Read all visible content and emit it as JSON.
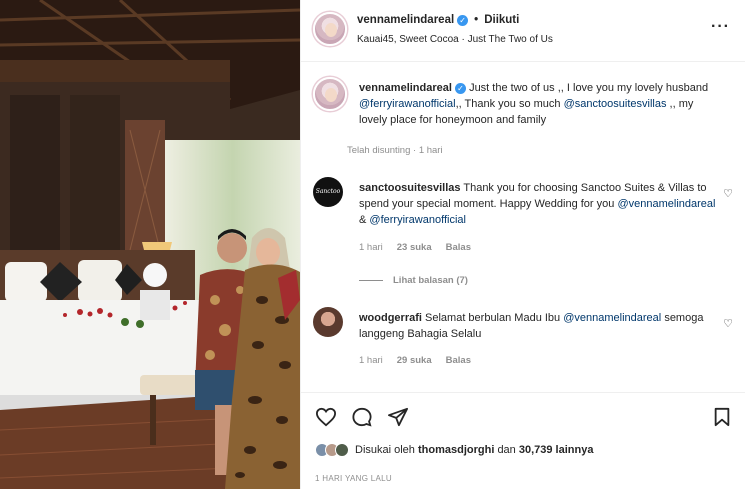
{
  "post": {
    "username": "vennamelindareal",
    "follow_status": "Diikuti",
    "location": "Kauai45, Sweet Cocoa · Just The Two of Us",
    "more_icon": "more-horizontal-icon"
  },
  "caption": {
    "username": "vennamelindareal",
    "text_1": "Just the two of us ,, I love you my lovely husband",
    "mention_1": "@ferryirawanofficial",
    "text_2": ",, Thank you so much",
    "mention_2": "@sanctoosuitesvillas",
    "text_3": ",, my lovely place for honeymoon and family",
    "edited": "Telah disunting · 1 hari"
  },
  "comments": [
    {
      "username": "sanctoosuitesvillas",
      "avatar_text": "Sanctoo Suites",
      "text_1": "Thank you for choosing Sanctoo Suites & Villas to spend your special moment. Happy Wedding for you",
      "mention_1": "@vennamelindareal",
      "text_2": "&",
      "mention_2": "@ferryirawanofficial",
      "time": "1 hari",
      "likes": "23 suka",
      "reply": "Balas",
      "view_replies": "Lihat balasan (7)"
    },
    {
      "username": "woodgerrafi",
      "text_1": "Selamat berbulan Madu Ibu",
      "mention_1": "@vennamelindareal",
      "text_2": "semoga langgeng Bahagia Selalu",
      "time": "1 hari",
      "likes": "29 suka",
      "reply": "Balas"
    }
  ],
  "actions": {
    "like_icon": "heart-icon",
    "comment_icon": "comment-icon",
    "share_icon": "paper-plane-icon",
    "save_icon": "bookmark-icon"
  },
  "likes": {
    "prefix": "Disukai oleh",
    "user": "thomasdjorghi",
    "middle": "dan",
    "count": "30,739 lainnya"
  },
  "timestamp": "1 HARI YANG LALU",
  "colors": {
    "mention": "#00376b",
    "verified": "#3897f0",
    "muted": "#8e8e8e"
  }
}
